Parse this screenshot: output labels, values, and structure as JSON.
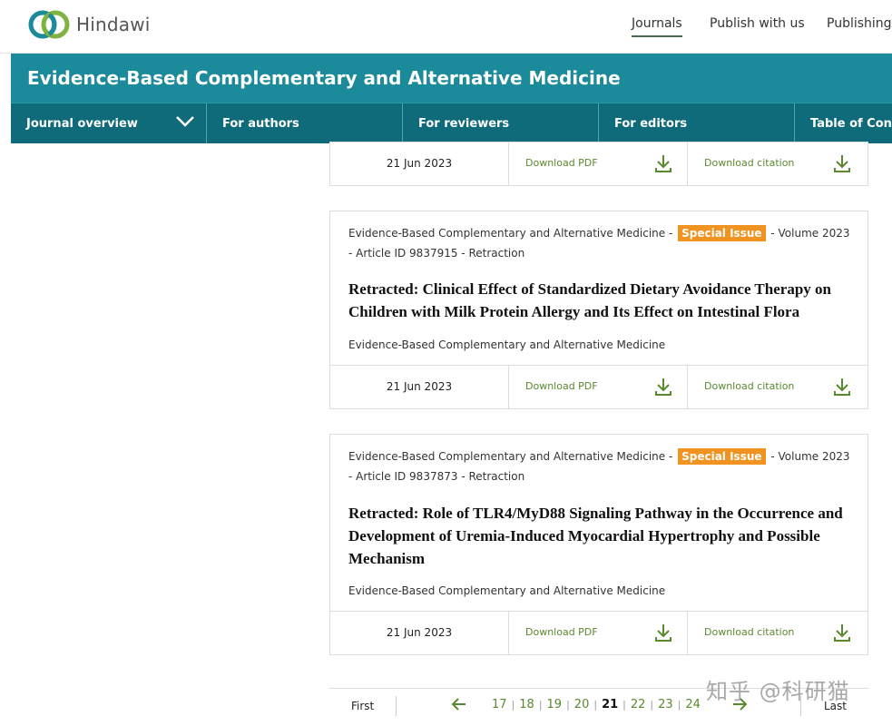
{
  "brand": {
    "name": "Hindawi",
    "logo_icon": "hindawi-rings-logo",
    "colors": {
      "teal": "#1b8a9a",
      "teal_dark": "#0f6b79",
      "badge": "#f19320",
      "link_green": "#5a8a2e"
    }
  },
  "topnav": {
    "items": [
      "Journals",
      "Publish with us",
      "Publishing"
    ]
  },
  "journal": {
    "title": "Evidence-Based Complementary and Alternative Medicine",
    "subnav": [
      "Journal overview",
      "For authors",
      "For reviewers",
      "For editors",
      "Table of Contents"
    ]
  },
  "articles": [
    {
      "date": "21 Jun 2023",
      "download_pdf": "Download PDF",
      "download_citation": "Download citation"
    },
    {
      "journal": "Evidence-Based Complementary and Alternative Medicine -",
      "badge": "Special Issue",
      "volume": "- Volume 2023",
      "article_id": "- Article ID 9837915 - Retraction",
      "title": "Retracted: Clinical Effect of Standardized Dietary Avoidance Therapy on Children with Milk Protein Allergy and Its Effect on Intestinal Flora",
      "journal_name": "Evidence-Based Complementary and Alternative Medicine",
      "date": "21 Jun 2023",
      "download_pdf": "Download PDF",
      "download_citation": "Download citation"
    },
    {
      "journal": "Evidence-Based Complementary and Alternative Medicine -",
      "badge": "Special Issue",
      "volume": "- Volume 2023",
      "article_id": "- Article ID 9837873 - Retraction",
      "title": "Retracted: Role of TLR4/MyD88 Signaling Pathway in the Occurrence and Development of Uremia-Induced Myocardial Hypertrophy and Possible Mechanism",
      "journal_name": "Evidence-Based Complementary and Alternative Medicine",
      "date": "21 Jun 2023",
      "download_pdf": "Download PDF",
      "download_citation": "Download citation"
    }
  ],
  "pagination": {
    "first": "First",
    "last": "Last",
    "pages": [
      "17",
      "18",
      "19",
      "20",
      "21",
      "22",
      "23",
      "24"
    ],
    "current": "21",
    "separator": "|"
  },
  "watermark": "知乎 @科研猫"
}
